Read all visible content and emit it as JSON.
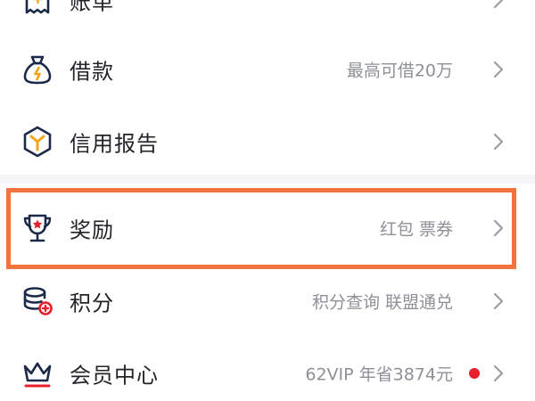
{
  "menu": {
    "bill": {
      "label": "账单"
    },
    "loan": {
      "label": "借款",
      "value": "最高可借20万"
    },
    "credit_report": {
      "label": "信用报告"
    },
    "rewards": {
      "label": "奖励",
      "value": "红包 票券"
    },
    "points": {
      "label": "积分",
      "value": "积分查询 联盟通兑"
    },
    "membership": {
      "label": "会员中心",
      "value": "62VIP 年省3874元"
    }
  },
  "icons": {
    "bill": "bill-icon",
    "loan": "money-bag-icon",
    "credit_report": "hexagon-y-icon",
    "rewards": "trophy-star-icon",
    "points": "coin-stack-icon",
    "membership": "crown-icon",
    "chevron": "chevron-right-icon"
  },
  "colors": {
    "icon_navy": "#1c2a4a",
    "icon_gold": "#f0a51a",
    "icon_red": "#e8202c",
    "highlight": "#f2733f",
    "notification_dot": "#e8202c"
  }
}
